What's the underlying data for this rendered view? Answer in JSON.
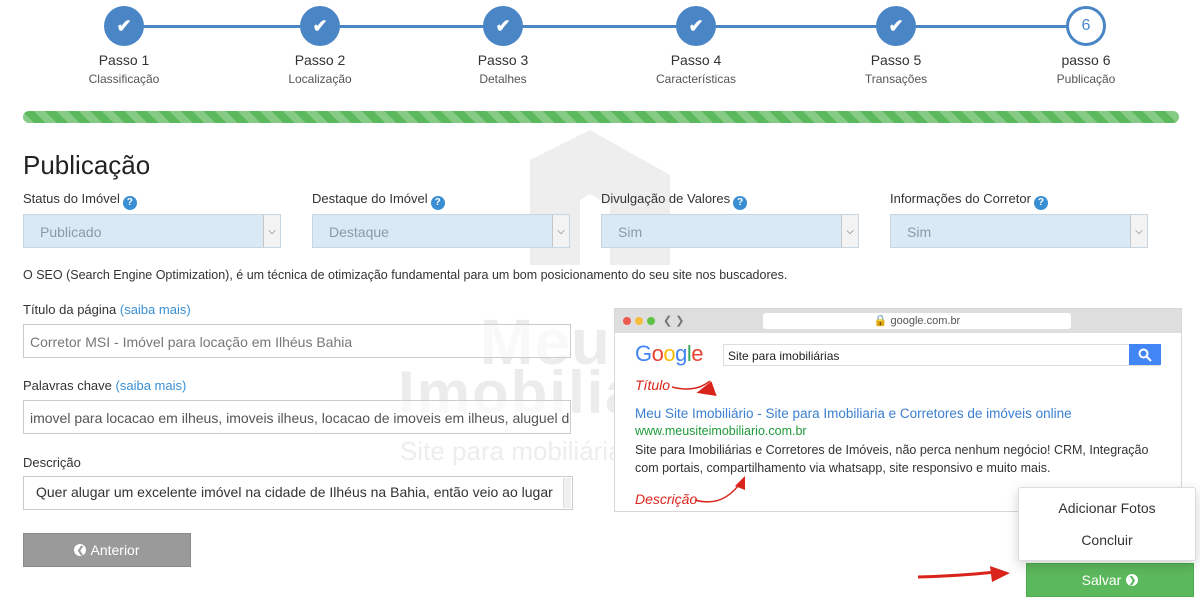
{
  "stepper": {
    "steps": [
      {
        "title": "Passo 1",
        "subtitle": "Classificação",
        "status": "done"
      },
      {
        "title": "Passo 2",
        "subtitle": "Localização",
        "status": "done"
      },
      {
        "title": "Passo 3",
        "subtitle": "Detalhes",
        "status": "done"
      },
      {
        "title": "Passo 4",
        "subtitle": "Características",
        "status": "done"
      },
      {
        "title": "Passo 5",
        "subtitle": "Transações",
        "status": "done"
      },
      {
        "title": "passo 6",
        "subtitle": "Publicação",
        "status": "current",
        "number": "6"
      }
    ],
    "done_icon": "check-icon",
    "progress": 1.0,
    "accent_color": "#4a86c5",
    "progress_color": "#5cb85c"
  },
  "page": {
    "title": "Publicação"
  },
  "selects": {
    "status": {
      "label": "Status do Imóvel",
      "value": "Publicado"
    },
    "destaque": {
      "label": "Destaque do Imóvel",
      "value": "Destaque"
    },
    "valores": {
      "label": "Divulgação de Valores",
      "value": "Sim"
    },
    "corretor": {
      "label": "Informações do Corretor",
      "value": "Sim"
    },
    "help_icon": "?"
  },
  "seo": {
    "intro": "O SEO (Search Engine Optimization), é um técnica de otimização fundamental para um bom posicionamento do seu site nos buscadores.",
    "title_label": "Título da página",
    "title_link": "(saiba mais)",
    "title_value": "Corretor MSI - Imóvel para locação em Ilhéus Bahia",
    "keywords_label": "Palavras chave",
    "keywords_link": "(saiba mais)",
    "keywords_value": "imovel para locacao em ilheus, imoveis ilheus, locacao de imoveis em ilheus, aluguel de",
    "description_label": "Descrição",
    "description_value": "Quer alugar um excelente imóvel na cidade de Ilhéus na Bahia, então veio ao lugar"
  },
  "preview": {
    "url": "google.com.br",
    "logo": "Google",
    "search_query": "Site para imobiliárias",
    "annotation_title": "Título",
    "annotation_description": "Descrição",
    "result_title": "Meu Site Imobiliário - Site para Imobiliaria e Corretores de imóveis online",
    "result_url": "www.meusiteimobiliario.com.br",
    "result_description": "Site para Imobiliárias e Corretores de Imóveis, não perca nenhum negócio! CRM, Integração com portais, compartilhamento via whatsapp, site responsivo e muito mais."
  },
  "watermark": {
    "line1": "Meu Site",
    "line2": "Imobiliário",
    "line3": "Site para mobiliária"
  },
  "buttons": {
    "previous": "Anterior",
    "save": "Salvar",
    "dropup_items": [
      "Adicionar Fotos",
      "Concluir"
    ]
  }
}
